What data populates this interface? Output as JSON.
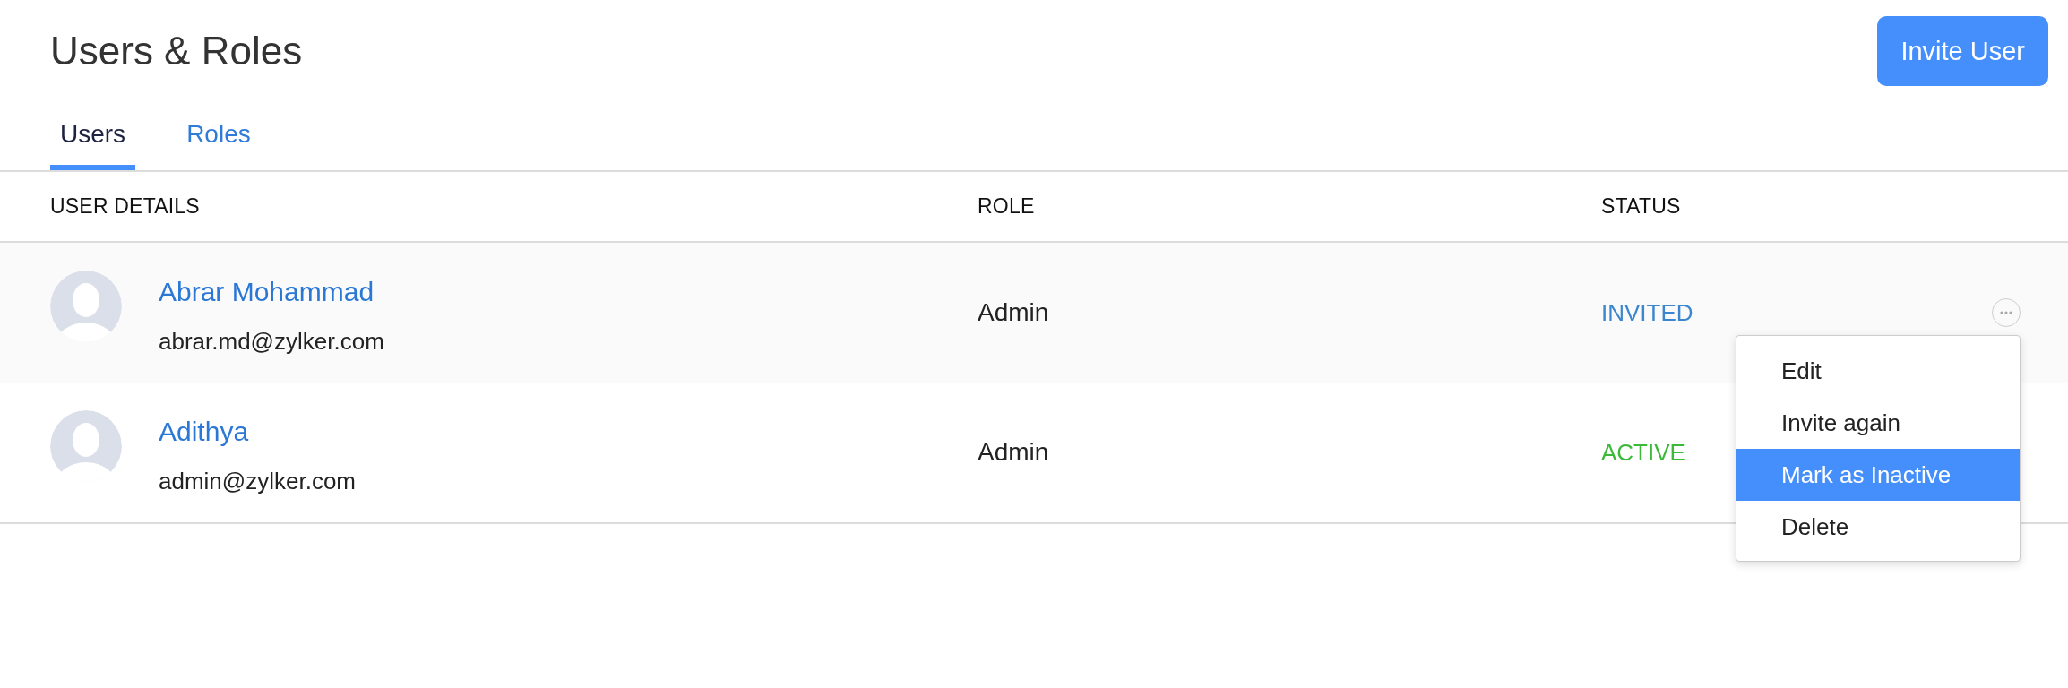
{
  "page": {
    "title": "Users & Roles",
    "invite_button": "Invite User"
  },
  "tabs": [
    {
      "label": "Users",
      "selected": true
    },
    {
      "label": "Roles",
      "selected": false
    }
  ],
  "table": {
    "columns": [
      "USER DETAILS",
      "ROLE",
      "STATUS"
    ],
    "rows": [
      {
        "name": "Abrar Mohammad",
        "email": "abrar.md@zylker.com",
        "role": "Admin",
        "status": {
          "label": "INVITED",
          "color": "#3a86d0"
        },
        "hovered": true,
        "menu": {
          "items": [
            {
              "label": "Edit",
              "selected": false
            },
            {
              "label": "Invite again",
              "selected": false
            },
            {
              "label": "Mark as Inactive",
              "selected": true
            },
            {
              "label": "Delete",
              "selected": false
            }
          ]
        }
      },
      {
        "name": "Adithya",
        "email": "admin@zylker.com",
        "role": "Admin",
        "status": {
          "label": "ACTIVE",
          "color": "#3db93a"
        },
        "hovered": false
      }
    ]
  }
}
